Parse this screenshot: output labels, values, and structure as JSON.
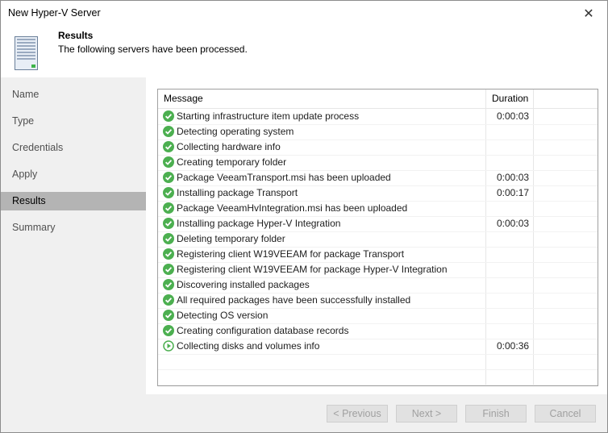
{
  "window": {
    "title": "New Hyper-V Server",
    "close_glyph": "✕"
  },
  "header": {
    "title": "Results",
    "subtitle": "The following servers have been processed.",
    "icon": "server-icon"
  },
  "sidebar": {
    "items": [
      {
        "label": "Name",
        "active": false
      },
      {
        "label": "Type",
        "active": false
      },
      {
        "label": "Credentials",
        "active": false
      },
      {
        "label": "Apply",
        "active": false
      },
      {
        "label": "Results",
        "active": true
      },
      {
        "label": "Summary",
        "active": false
      }
    ]
  },
  "log": {
    "columns": {
      "message": "Message",
      "duration": "Duration"
    },
    "rows": [
      {
        "status": "success",
        "message": "Starting infrastructure item update process",
        "duration": "0:00:03"
      },
      {
        "status": "success",
        "message": "Detecting operating system",
        "duration": ""
      },
      {
        "status": "success",
        "message": "Collecting hardware info",
        "duration": ""
      },
      {
        "status": "success",
        "message": "Creating temporary folder",
        "duration": ""
      },
      {
        "status": "success",
        "message": "Package VeeamTransport.msi has been uploaded",
        "duration": "0:00:03"
      },
      {
        "status": "success",
        "message": "Installing package Transport",
        "duration": "0:00:17"
      },
      {
        "status": "success",
        "message": "Package VeeamHvIntegration.msi has been uploaded",
        "duration": ""
      },
      {
        "status": "success",
        "message": "Installing package Hyper-V Integration",
        "duration": "0:00:03"
      },
      {
        "status": "success",
        "message": "Deleting temporary folder",
        "duration": ""
      },
      {
        "status": "success",
        "message": "Registering client W19VEEAM for package Transport",
        "duration": ""
      },
      {
        "status": "success",
        "message": "Registering client W19VEEAM for package Hyper-V Integration",
        "duration": ""
      },
      {
        "status": "success",
        "message": "Discovering installed packages",
        "duration": ""
      },
      {
        "status": "success",
        "message": "All required packages have been successfully installed",
        "duration": ""
      },
      {
        "status": "success",
        "message": "Detecting OS version",
        "duration": ""
      },
      {
        "status": "success",
        "message": "Creating configuration database records",
        "duration": ""
      },
      {
        "status": "in-progress",
        "message": "Collecting disks and volumes info",
        "duration": "0:00:36"
      }
    ]
  },
  "buttons": {
    "previous": "< Previous",
    "next": "Next >",
    "finish": "Finish",
    "cancel": "Cancel"
  },
  "colors": {
    "success": "#4caf50",
    "active_nav": "#b4b4b4"
  }
}
